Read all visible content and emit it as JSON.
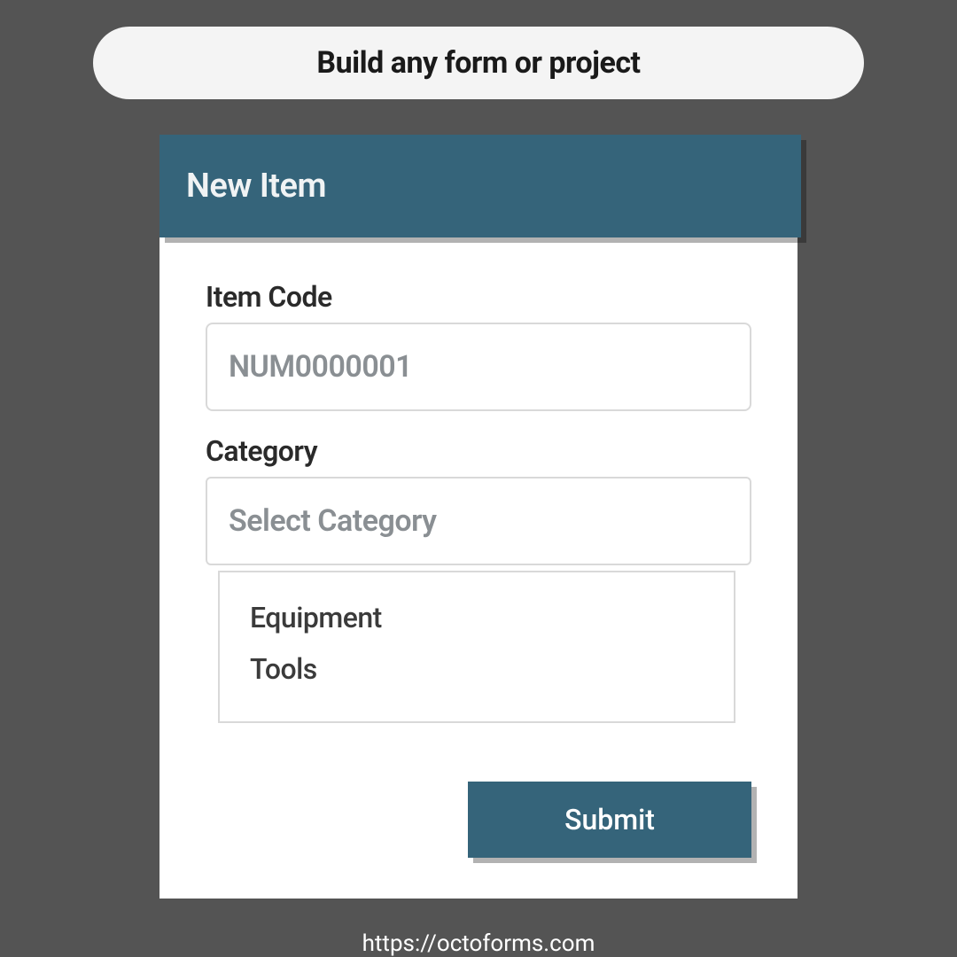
{
  "banner": {
    "text": "Build any form or project"
  },
  "card": {
    "title": "New Item",
    "fields": {
      "item_code": {
        "label": "Item Code",
        "placeholder": "NUM0000001",
        "value": ""
      },
      "category": {
        "label": "Category",
        "placeholder": "Select Category",
        "options": [
          "Equipment",
          "Tools"
        ]
      }
    },
    "submit_label": "Submit"
  },
  "footer_url": "https://octoforms.com",
  "colors": {
    "accent": "#35647a",
    "bg": "#545454"
  }
}
